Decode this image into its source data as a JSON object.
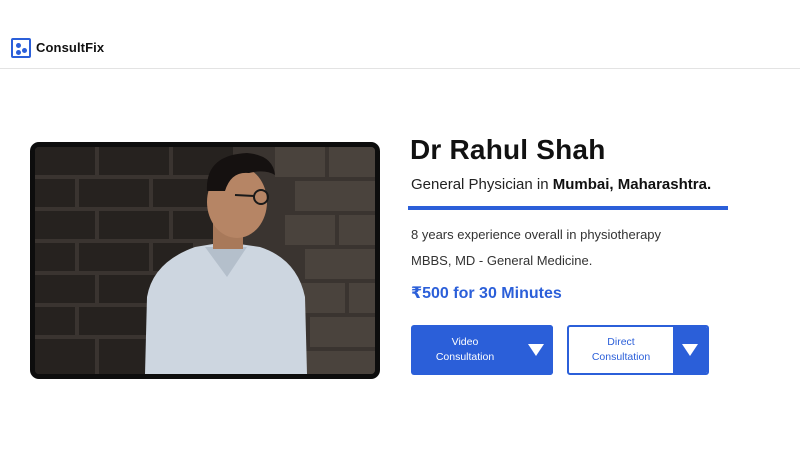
{
  "brand": {
    "name": "ConsultFix",
    "icon": "people-grid-icon",
    "accent": "#2b5fd9"
  },
  "doctor": {
    "name": "Dr Rahul Shah",
    "specialty_prefix": "General Physician in ",
    "location": "Mumbai, Maharashtra.",
    "experience": "8 years experience overall in physiotherapy",
    "degree": "MBBS, MD - General Medicine.",
    "price": "₹500 for 30 Minutes",
    "photo": "doctor-portrait-photo"
  },
  "actions": {
    "video": {
      "label_line1": "Video",
      "label_line2": "Consultation",
      "icon": "caret-down-icon"
    },
    "direct": {
      "label_line1": "Direct",
      "label_line2": "Consultation",
      "icon": "caret-down-icon"
    }
  }
}
